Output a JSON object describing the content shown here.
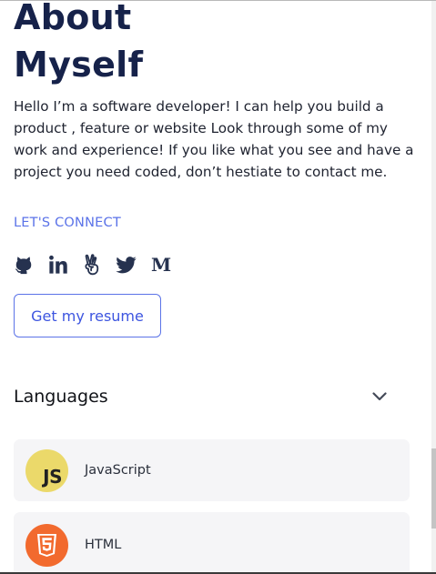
{
  "about": {
    "title_line1": "About",
    "title_line2": "Myself",
    "bio": "Hello I’m a software developer! I can help you build a product , feature or website Look through some of my work and experience! If you like what you see and have a project you need coded, don’t hestiate to contact me.",
    "connect_label": "LET'S CONNECT",
    "resume_button_label": "Get my resume"
  },
  "socials": [
    {
      "name": "github-icon"
    },
    {
      "name": "linkedin-icon"
    },
    {
      "name": "angellist-icon"
    },
    {
      "name": "twitter-icon"
    },
    {
      "name": "medium-icon",
      "glyph": "M"
    }
  ],
  "languages": {
    "title": "Languages",
    "toggle_icon": "chevron-down-icon",
    "items": [
      {
        "name": "JavaScript",
        "logo_text": "JS",
        "logo_color": "#ebd96a"
      },
      {
        "name": "HTML",
        "logo_text": "5",
        "logo_color": "#f26a2e"
      }
    ]
  },
  "colors": {
    "heading": "#16224a",
    "accent": "#5b73e8",
    "card_background": "#f5f5f7",
    "icon": "#26324f"
  }
}
